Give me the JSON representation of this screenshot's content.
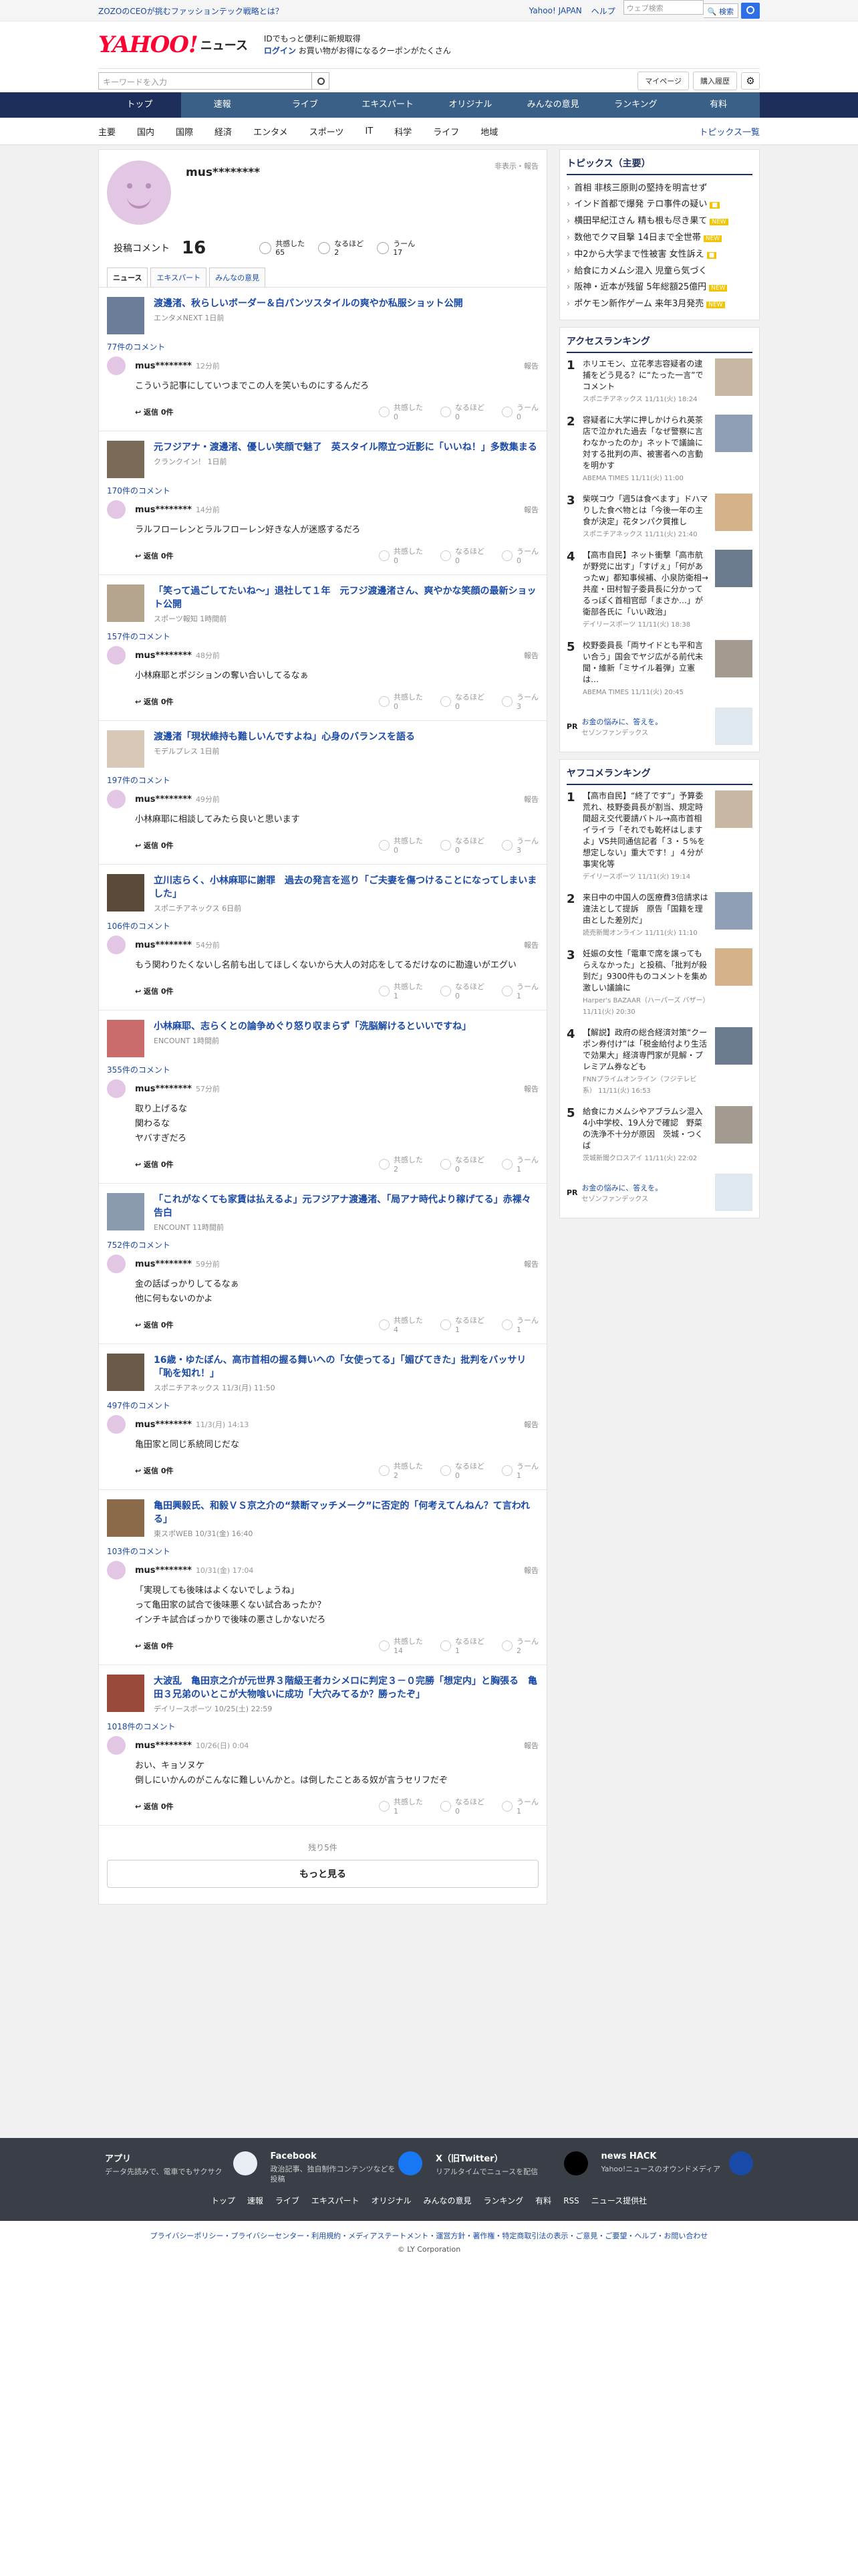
{
  "topbar": {
    "promo": "ZOZOのCEOが挑むファッションテック戦略とは？",
    "links": [
      "Yahoo! JAPAN",
      "ヘルプ"
    ],
    "search_placeholder": "ウェブ検索",
    "search_button": "🔍 検索"
  },
  "brand": {
    "logo": "YAHOO!",
    "logo_sub": "ニュース",
    "login_line1": "IDでもっと便利に新規取得",
    "login_link": "ログイン",
    "login_line2": "お買い物がお得になるクーポンがたくさん"
  },
  "controls": {
    "keyword_placeholder": "キーワードを入力",
    "mypage": "マイページ",
    "purchase": "購入履歴",
    "gear": "⚙"
  },
  "nav1": [
    "トップ",
    "速報",
    "ライブ",
    "エキスパート",
    "オリジナル",
    "みんなの意見",
    "ランキング",
    "有料"
  ],
  "nav2": [
    "主要",
    "国内",
    "国際",
    "経済",
    "エンタメ",
    "スポーツ",
    "IT",
    "科学",
    "ライフ",
    "地域"
  ],
  "nav2_right": "トピックス一覧",
  "profile": {
    "name": "mus********",
    "report": "非表示・報告",
    "posted_label": "投稿コメント",
    "posted_count": "16",
    "reactions": [
      {
        "label": "共感した",
        "value": "65"
      },
      {
        "label": "なるほど",
        "value": "2"
      },
      {
        "label": "うーん",
        "value": "17"
      }
    ]
  },
  "tabs": [
    "ニュース",
    "エキスパート",
    "みんなの意見"
  ],
  "articles": [
    {
      "title": "渡邊渚、秋らしいボーダー＆白パンツスタイルの爽やか私服ショット公開",
      "source": "エンタメNEXT 1日前",
      "count": "77件のコメント",
      "time": "12分前",
      "body": "こういう記事にしていつまでこの人を笑いものにするんだろ",
      "r": [
        "0",
        "0",
        "0"
      ]
    },
    {
      "title": "元フジアナ・渡邊渚、優しい笑顔で魅了　英スタイル際立つ近影に「いいね！」多数集まる",
      "source": "クランクイン！ 1日前",
      "count": "170件のコメント",
      "time": "14分前",
      "body": "ラルフローレンとラルフローレン好きな人が迷惑するだろ",
      "r": [
        "0",
        "0",
        "0"
      ]
    },
    {
      "title": "「笑って過ごしてたいね～」退社して１年　元フジ渡邊渚さん、爽やかな笑顔の最新ショット公開",
      "source": "スポーツ報知 1時間前",
      "count": "157件のコメント",
      "time": "48分前",
      "body": "小林麻耶とポジションの奪い合いしてるなぁ",
      "r": [
        "0",
        "0",
        "3"
      ]
    },
    {
      "title": "渡邊渚「現状維持も難しいんですよね」心身のバランスを語る",
      "source": "モデルプレス 1日前",
      "count": "197件のコメント",
      "time": "49分前",
      "body": "小林麻耶に相談してみたら良いと思います",
      "r": [
        "0",
        "0",
        "3"
      ]
    },
    {
      "title": "立川志らく、小林麻耶に謝罪　過去の発言を巡り「ご夫妻を傷つけることになってしまいました」",
      "source": "スポニチアネックス 6日前",
      "count": "106件のコメント",
      "time": "54分前",
      "body": "もう関わりたくないし名前も出してほしくないから大人の対応をしてるだけなのに勘違いがエグい",
      "r": [
        "1",
        "0",
        "1"
      ]
    },
    {
      "title": "小林麻耶、志らくとの論争めぐり怒り収まらず「洗脳解けるといいですね」",
      "source": "ENCOUNT 1時間前",
      "count": "355件のコメント",
      "time": "57分前",
      "body": "取り上げるな\n関わるな\nヤバすぎだろ",
      "r": [
        "2",
        "0",
        "1"
      ]
    },
    {
      "title": "「これがなくても家賃は払えるよ」元フジアナ渡邊渚、「局アナ時代より稼げてる」赤裸々告白",
      "source": "ENCOUNT 11時間前",
      "count": "752件のコメント",
      "time": "59分前",
      "body": "金の話ばっかりしてるなぁ\n他に何もないのかよ",
      "r": [
        "4",
        "1",
        "1"
      ]
    },
    {
      "title": "16歳・ゆたぼん、高市首相の握る舞いへの「女使ってる」「媚びてきた」批判をバッサリ「恥を知れ！」",
      "source": "スポニチアネックス 11/3(月) 11:50",
      "count": "497件のコメント",
      "time": "11/3(月) 14:13",
      "body": "亀田家と同じ系統同じだな",
      "r": [
        "2",
        "0",
        "1"
      ]
    },
    {
      "title": "亀田興毅氏、和毅ＶＳ京之介の“禁断マッチメーク”に否定的「何考えてんねん？て言われる」",
      "source": "東スポWEB 10/31(金) 16:40",
      "count": "103件のコメント",
      "time": "10/31(金) 17:04",
      "body": "「実現しても後味はよくないでしょうね」\nって亀田家の試合で後味悪くない試合あったか？\nインチキ試合ばっかりで後味の悪さしかないだろ",
      "r": [
        "14",
        "1",
        "2"
      ]
    },
    {
      "title": "大波乱　亀田京之介が元世界３階級王者カシメロに判定３－０完勝「想定内」と胸張る　亀田３兄弟のいとこが大物喰いに成功「大穴みてるか？勝ったぞ」",
      "source": "デイリースポーツ 10/25(土) 22:59",
      "count": "1018件のコメント",
      "time": "10/26(日) 0:04",
      "body": "おい、キョソヌケ\n倒しにいかんのがこんなに難しいんかと。は倒したことある奴が言うセリフだぞ",
      "r": [
        "1",
        "0",
        "1"
      ]
    }
  ],
  "comment_user": "mus********",
  "labels": {
    "reply": "返信",
    "reply_count": "0件",
    "report": "報告",
    "reacts": [
      "共感した",
      "なるほど",
      "うーん"
    ]
  },
  "more": {
    "remaining": "残り5件",
    "button": "もっと見る"
  },
  "side": {
    "topics_title": "トピックス（主要）",
    "topics": [
      {
        "t": "首相 非核三原則の堅持を明言せず",
        "n": ""
      },
      {
        "t": "インド首都で爆発 テロ事件の疑い",
        "n": "■"
      },
      {
        "t": "横田早紀江さん 精も根も尽き果て",
        "n": "NEW"
      },
      {
        "t": "数他でクマ目撃 14日まで全世帯",
        "n": "NEW"
      },
      {
        "t": "中2から大学まで性被害 女性訴え",
        "n": "■"
      },
      {
        "t": "給食にカメムシ混入 児童ら気づく",
        "n": ""
      },
      {
        "t": "阪神・近本が残留 5年総額25億円",
        "n": "NEW"
      },
      {
        "t": "ポケモン新作ゲーム 来年3月発売",
        "n": "NEW"
      }
    ],
    "access_title": "アクセスランキング",
    "access": [
      {
        "t": "ホリエモン、立花孝志容疑者の逮捕をどう見る？に“たった一言”でコメント",
        "s": "スポニチアネックス 11/11(火) 18:24"
      },
      {
        "t": "容疑者に大学に押しかけられ英茶店で泣かれた過去「なぜ警察に言わなかったのか」ネットで議論に対する批判の声、被害者への言動を明かす",
        "s": "ABEMA TIMES 11/11(火) 11:00"
      },
      {
        "t": "柴咲コウ「週5は食べます」ドハマりした食べ物とは「今後一年の主食が決定」花タンパク質推し",
        "s": "スポニチアネックス 11/11(火) 21:40"
      },
      {
        "t": "【高市自民】ネット衝撃「高市航が野党に出す」「すげぇ」「何があったw」都知事候補、小泉防衛相→共産・田村智子委員長に分かってるっぽく首相官邸「まさか…」が衛部各氏に「いい政治」",
        "s": "デイリースポーツ 11/11(火) 18:38"
      },
      {
        "t": "校野委員長「両サイドとも平和言い合う」国会でヤジ広がる前代未聞・維新「ミサイル着弾」立憲は…",
        "s": "ABEMA TIMES 11/11(火) 20:45"
      }
    ],
    "pr1": {
      "b": "PR",
      "t": "お金の悩みに、答えを。",
      "s": "セゾンファンデックス"
    },
    "yafuko_title": "ヤフコメランキング",
    "yafuko": [
      {
        "t": "【高市自民】“終了です”」予算委荒れ、枝野委員長が割当、規定時間超え交代要請バトル→高市首相イライラ「それでも乾杯はしますよ」VS共同通信記者「３・５%を想定しない」重大です！」４分が事実化等",
        "s": "デイリースポーツ 11/11(火) 19:14"
      },
      {
        "t": "来日中の中国人の医療費3倍請求は違法として提訴　原告「国籍を理由とした差別だ」",
        "s": "読売新聞オンライン 11/11(火) 11:10"
      },
      {
        "t": "妊娠の女性「電車で席を譲ってもらえなかった」と投稿、「批判が殺到だ」9300件ものコメントを集め激しい議論に",
        "s": "Harper's BAZAAR（ハーパーズ バザー） 11/11(火) 20:30"
      },
      {
        "t": "【解説】政府の総合経済対策“クーポン券付け”は「税金給付より生活で効果大」経済専門家が見解・プレミアム券なども",
        "s": "FNNプライムオンライン（フジテレビ系） 11/11(火) 16:53"
      },
      {
        "t": "給食にカメムシやアブラムシ混入　4小中学校、19人分で確認　野菜の洗浄不十分が原因　茨城・つくば",
        "s": "茨城新聞クロスアイ 11/11(火) 22:02"
      }
    ],
    "pr2": {
      "b": "PR",
      "t": "お金の悩みに、答えを。",
      "s": "セゾンファンデックス"
    }
  },
  "footer": {
    "cols": [
      {
        "h": "アプリ",
        "d": "データ先読みで、電車でもサクサク"
      },
      {
        "h": "Facebook",
        "d": "政治記事、独自制作コンテンツなどを投稿"
      },
      {
        "h": "X（旧Twitter）",
        "d": "リアルタイムでニュースを配信"
      },
      {
        "h": "news HACK",
        "d": "Yahoo!ニュースのオウンドメディア"
      }
    ],
    "links": [
      "トップ",
      "速報",
      "ライブ",
      "エキスパート",
      "オリジナル",
      "みんなの意見",
      "ランキング",
      "有料",
      "RSS",
      "ニュース提供社"
    ],
    "bottom_links": "プライバシーポリシー・プライバシーセンター・利用規約・メディアステートメント・運営方針・著作権・特定商取引法の表示・ご意見・ご要望・ヘルプ・お問い合わせ",
    "copyright": "© LY Corporation"
  },
  "colors": {
    "nav": "#1d2e5b",
    "accent": "#ff0033",
    "link": "#1a4aa8"
  }
}
